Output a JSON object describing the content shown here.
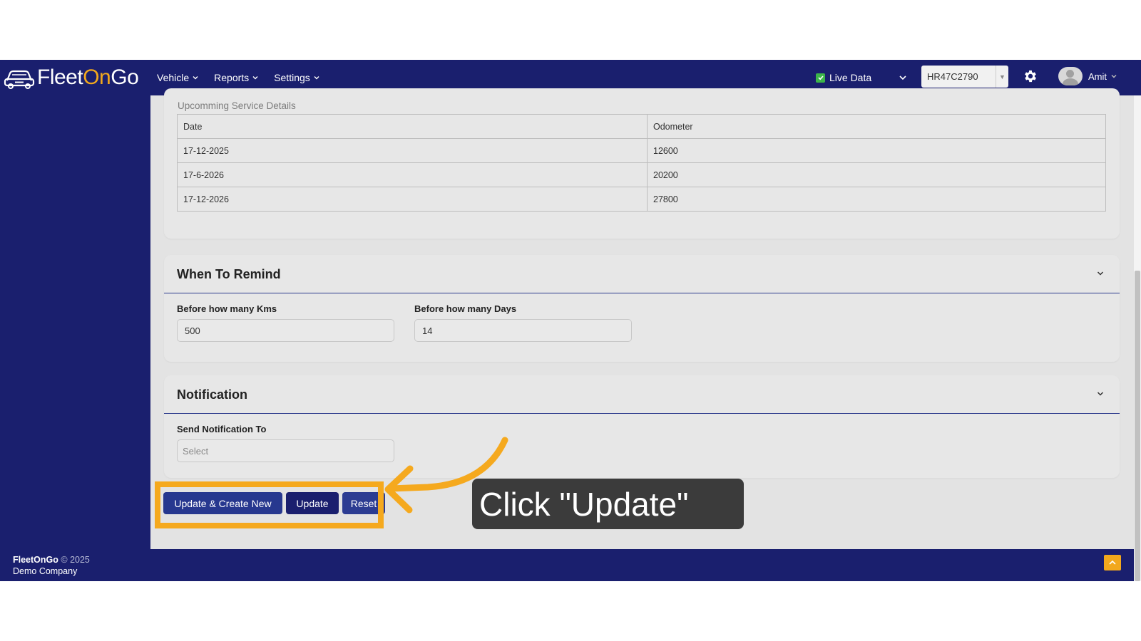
{
  "brand": {
    "part1": "Fleet",
    "part2": "On",
    "part3": "Go"
  },
  "nav": {
    "items": [
      {
        "label": "Vehicle"
      },
      {
        "label": "Reports"
      },
      {
        "label": "Settings"
      }
    ],
    "live_data_label": "Live Data",
    "vehicle_selected": "HR47C2790",
    "user_name": "Amit"
  },
  "service": {
    "section_title": "Upcomming Service Details",
    "columns": [
      "Date",
      "Odometer"
    ],
    "rows": [
      [
        "17-12-2025",
        "12600"
      ],
      [
        "17-6-2026",
        "20200"
      ],
      [
        "17-12-2026",
        "27800"
      ]
    ]
  },
  "remind": {
    "title": "When To Remind",
    "kms_label": "Before how many Kms",
    "kms_value": "500",
    "days_label": "Before how many Days",
    "days_value": "14"
  },
  "notification": {
    "title": "Notification",
    "send_to_label": "Send Notification To",
    "send_to_placeholder": "Select"
  },
  "actions": {
    "update_create_label": "Update & Create New",
    "update_label": "Update",
    "reset_label": "Reset"
  },
  "callout": {
    "text": "Click \"Update\""
  },
  "footer": {
    "brand": "FleetOnGo",
    "copyright": "© 2025",
    "company": "Demo Company"
  },
  "colors": {
    "navy": "#1a1f6e",
    "accent_orange": "#f5a91e",
    "button_blue": "#27388f",
    "content_bg": "#e3e3e3"
  }
}
